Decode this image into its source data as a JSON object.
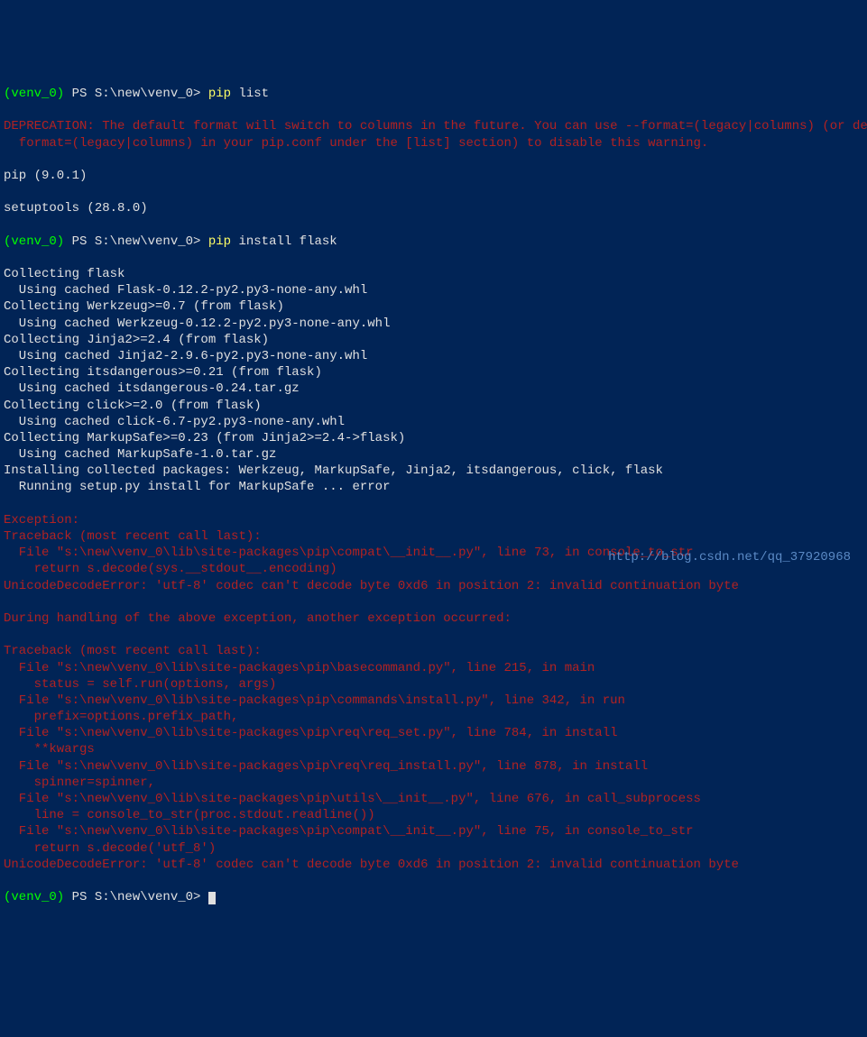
{
  "prompt1": {
    "venv": "(venv_0)",
    "path": " PS S:\\new\\venv_0> ",
    "cmd": "pip ",
    "args": "list"
  },
  "deprecation": "DEPRECATION: The default format will switch to columns in the future. You can use --format=(legacy|columns) (or define a\n  format=(legacy|columns) in your pip.conf under the [list] section) to disable this warning.",
  "pip_list_out1": "pip (9.0.1)",
  "pip_list_out2": "setuptools (28.8.0)",
  "prompt2": {
    "venv": "(venv_0)",
    "path": " PS S:\\new\\venv_0> ",
    "cmd": "pip ",
    "args": "install flask"
  },
  "install_lines": [
    "Collecting flask",
    "  Using cached Flask-0.12.2-py2.py3-none-any.whl",
    "Collecting Werkzeug>=0.7 (from flask)",
    "  Using cached Werkzeug-0.12.2-py2.py3-none-any.whl",
    "Collecting Jinja2>=2.4 (from flask)",
    "  Using cached Jinja2-2.9.6-py2.py3-none-any.whl",
    "Collecting itsdangerous>=0.21 (from flask)",
    "  Using cached itsdangerous-0.24.tar.gz",
    "Collecting click>=2.0 (from flask)",
    "  Using cached click-6.7-py2.py3-none-any.whl",
    "Collecting MarkupSafe>=0.23 (from Jinja2>=2.4->flask)",
    "  Using cached MarkupSafe-1.0.tar.gz",
    "Installing collected packages: Werkzeug, MarkupSafe, Jinja2, itsdangerous, click, flask",
    "  Running setup.py install for MarkupSafe ... error"
  ],
  "error_lines": [
    "Exception:",
    "Traceback (most recent call last):",
    "  File \"s:\\new\\venv_0\\lib\\site-packages\\pip\\compat\\__init__.py\", line 73, in console_to_str",
    "    return s.decode(sys.__stdout__.encoding)",
    "UnicodeDecodeError: 'utf-8' codec can't decode byte 0xd6 in position 2: invalid continuation byte",
    "",
    "During handling of the above exception, another exception occurred:",
    "",
    "Traceback (most recent call last):",
    "  File \"s:\\new\\venv_0\\lib\\site-packages\\pip\\basecommand.py\", line 215, in main",
    "    status = self.run(options, args)",
    "  File \"s:\\new\\venv_0\\lib\\site-packages\\pip\\commands\\install.py\", line 342, in run",
    "    prefix=options.prefix_path,",
    "  File \"s:\\new\\venv_0\\lib\\site-packages\\pip\\req\\req_set.py\", line 784, in install",
    "    **kwargs",
    "  File \"s:\\new\\venv_0\\lib\\site-packages\\pip\\req\\req_install.py\", line 878, in install",
    "    spinner=spinner,",
    "  File \"s:\\new\\venv_0\\lib\\site-packages\\pip\\utils\\__init__.py\", line 676, in call_subprocess",
    "    line = console_to_str(proc.stdout.readline())",
    "  File \"s:\\new\\venv_0\\lib\\site-packages\\pip\\compat\\__init__.py\", line 75, in console_to_str",
    "    return s.decode('utf_8')",
    "UnicodeDecodeError: 'utf-8' codec can't decode byte 0xd6 in position 2: invalid continuation byte"
  ],
  "prompt3": {
    "venv": "(venv_0)",
    "path": " PS S:\\new\\venv_0> "
  },
  "watermark": "http://blog.csdn.net/qq_37920968"
}
